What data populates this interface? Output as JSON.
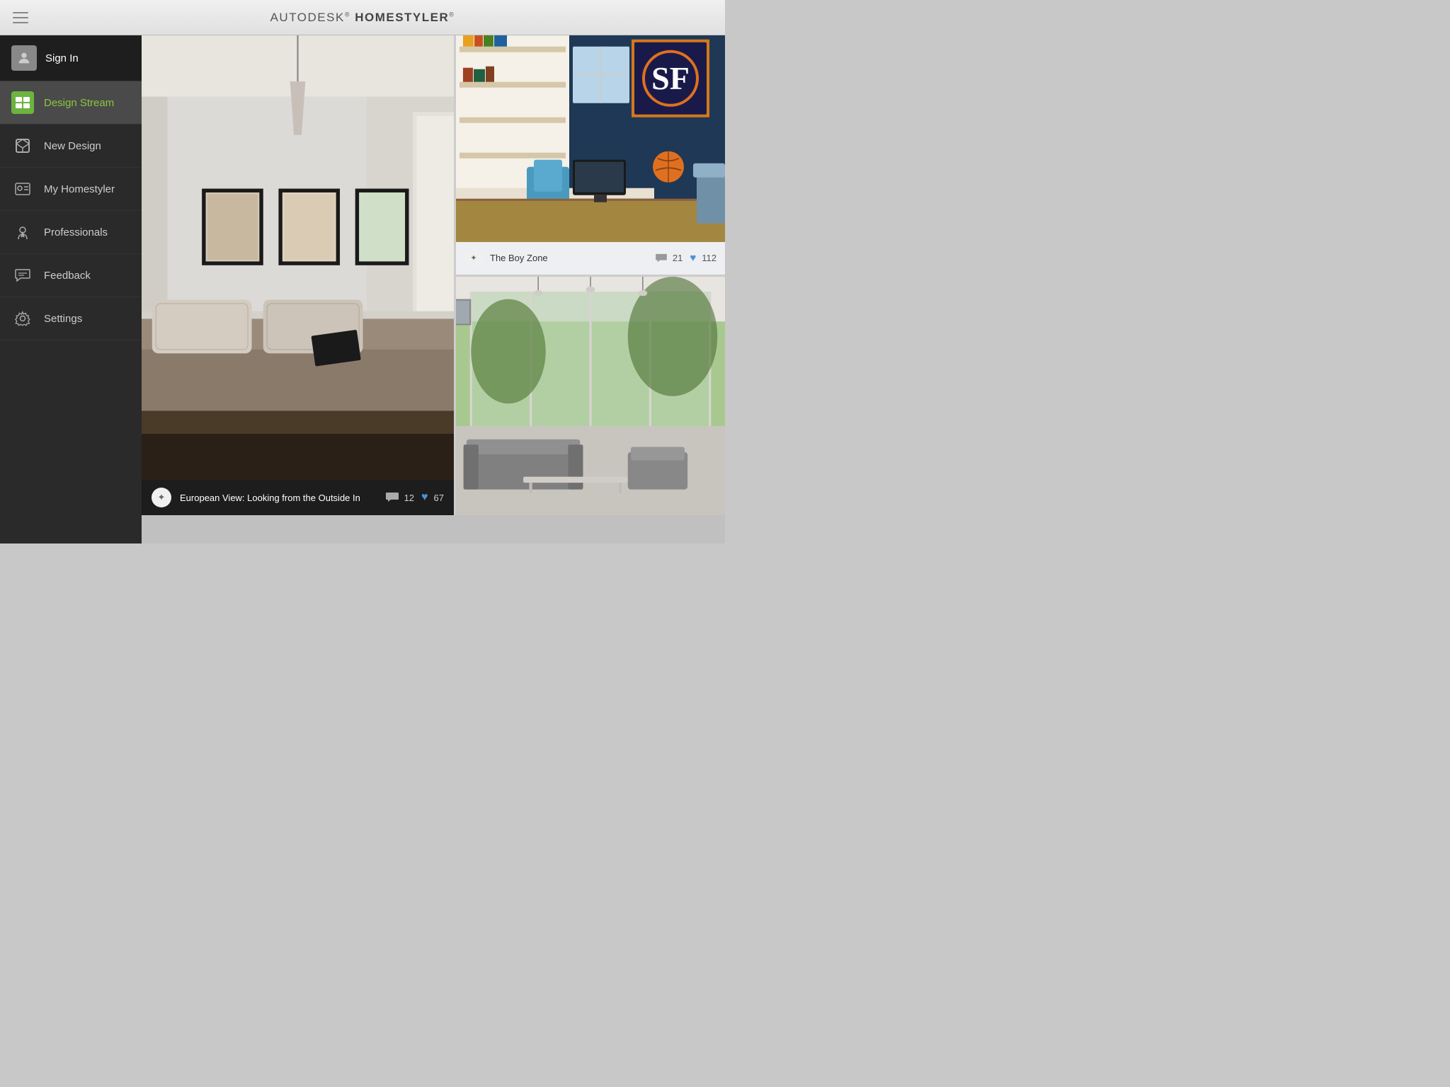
{
  "app": {
    "title_prefix": "AUTODESK",
    "title_trademark": "®",
    "title_bold": "HOMESTYLER",
    "title_trademark2": "®"
  },
  "sidebar": {
    "signin": {
      "label": "Sign In"
    },
    "items": [
      {
        "id": "design-stream",
        "label": "Design Stream",
        "active": true
      },
      {
        "id": "new-design",
        "label": "New Design",
        "active": false
      },
      {
        "id": "my-homestyler",
        "label": "My Homestyler",
        "active": false
      },
      {
        "id": "professionals",
        "label": "Professionals",
        "active": false
      },
      {
        "id": "feedback",
        "label": "Feedback",
        "active": false
      },
      {
        "id": "settings",
        "label": "Settings",
        "active": false
      }
    ]
  },
  "cards": {
    "left": {
      "title": "European View: Looking from the Outside In",
      "comments": "12",
      "likes": "67",
      "magic_icon": "✦"
    },
    "top_right": {
      "title": "The Boy Zone",
      "comments": "21",
      "likes": "112",
      "magic_icon": "✦"
    },
    "bottom_right": {
      "title": "",
      "comments": "",
      "likes": ""
    }
  },
  "colors": {
    "accent_green": "#6db33f",
    "accent_label_green": "#8dc63f",
    "sidebar_bg": "#2a2a2a",
    "sidebar_active": "#4a4a4a",
    "heart_blue": "#4a90d9",
    "topbar_bg": "#e8e8e8"
  }
}
